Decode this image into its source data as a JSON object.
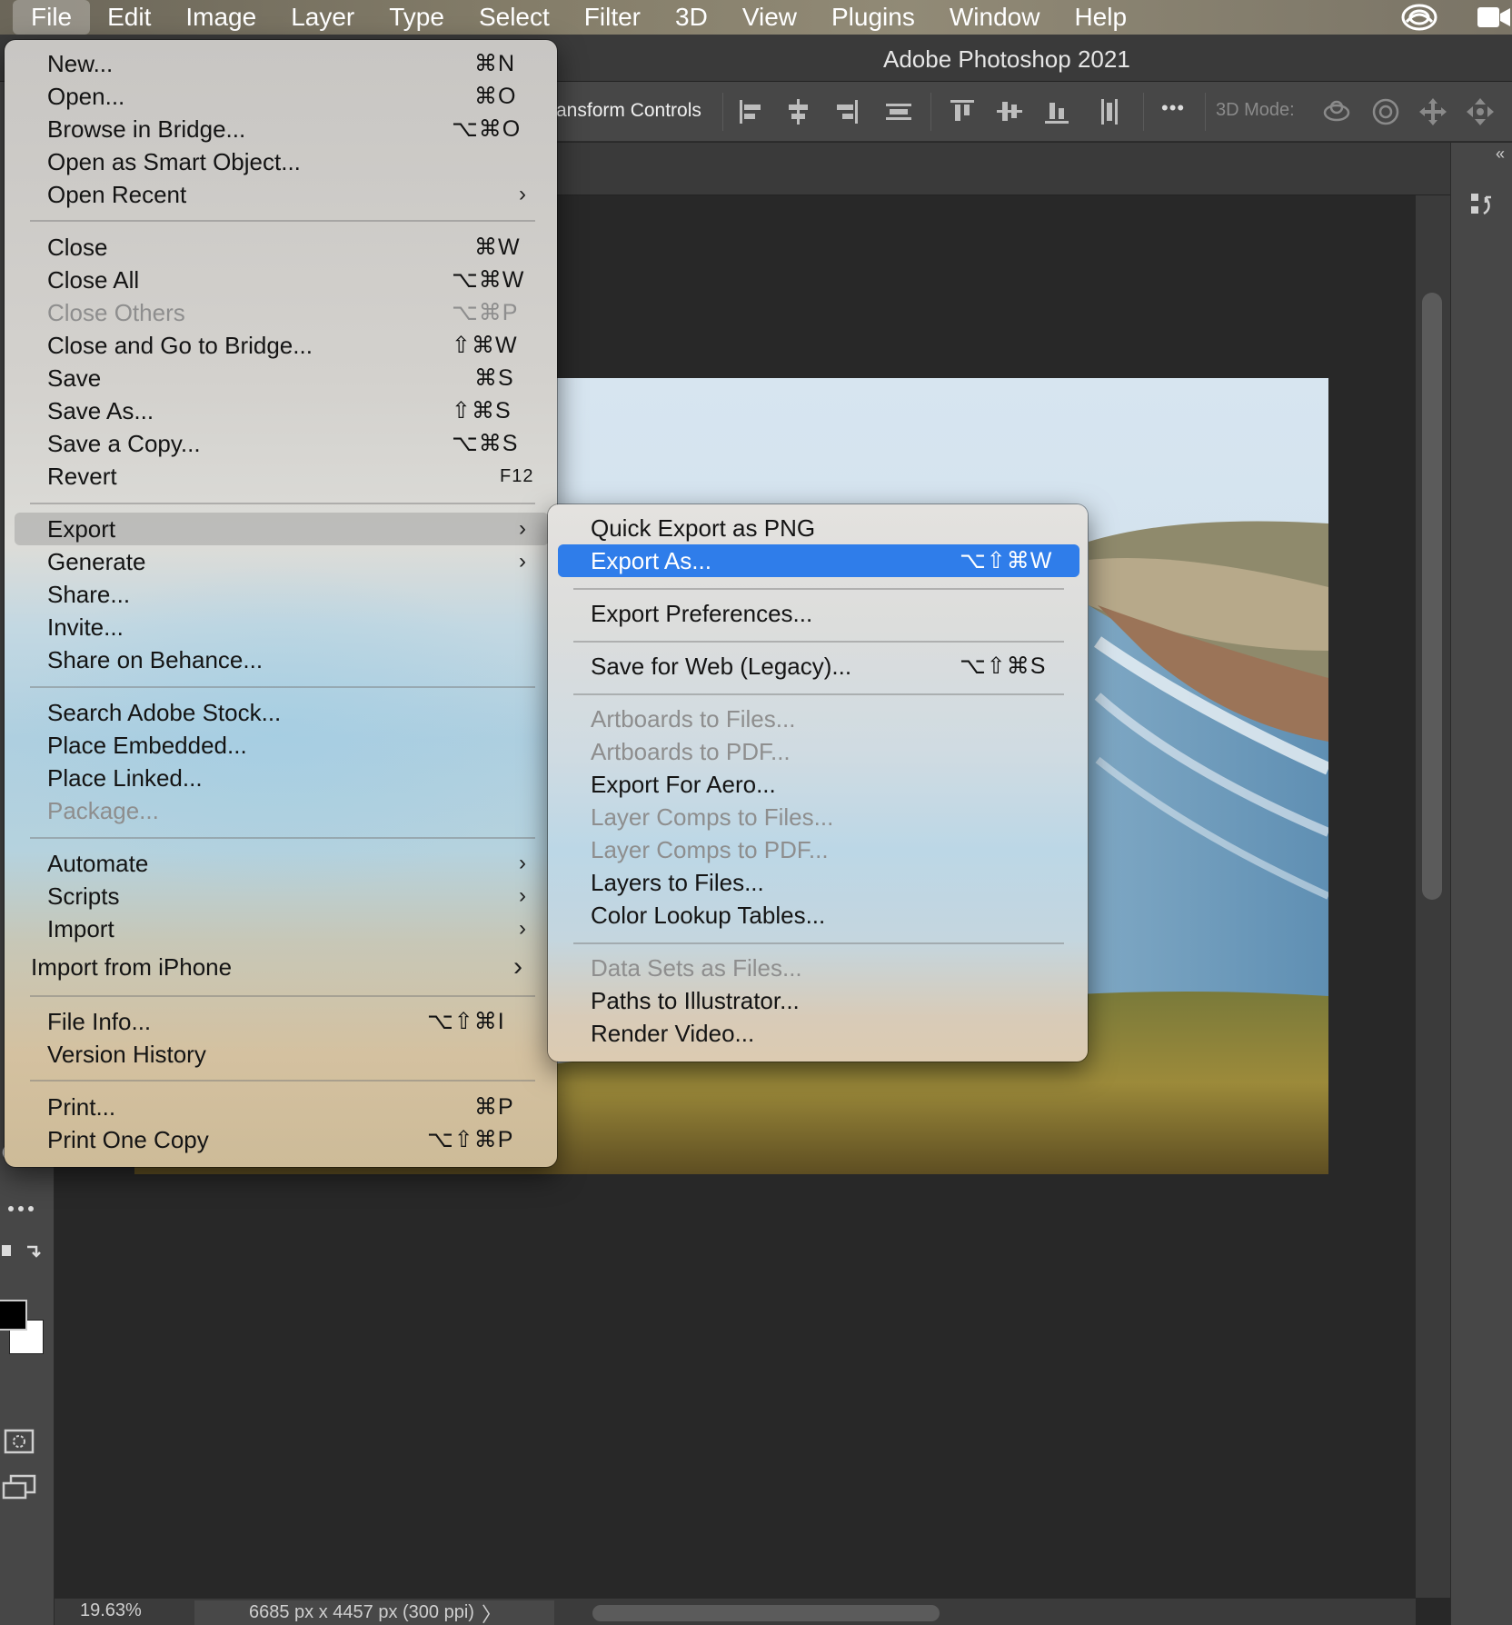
{
  "menubar": {
    "items": [
      "File",
      "Edit",
      "Image",
      "Layer",
      "Type",
      "Select",
      "Filter",
      "3D",
      "View",
      "Plugins",
      "Window",
      "Help"
    ],
    "active": "File",
    "right_icons": [
      "creative-cloud-icon",
      "facetime-icon"
    ]
  },
  "app": {
    "title": "Adobe Photoshop 2021"
  },
  "options_bar": {
    "transform_label": "ansform Controls",
    "mode_label": "3D Mode:",
    "more_label": "•••"
  },
  "file_menu": {
    "groups": [
      [
        {
          "label": "New...",
          "shortcut": "⌘N"
        },
        {
          "label": "Open...",
          "shortcut": "⌘O"
        },
        {
          "label": "Browse in Bridge...",
          "shortcut": "⌥⌘O"
        },
        {
          "label": "Open as Smart Object...",
          "shortcut": ""
        },
        {
          "label": "Open Recent",
          "submenu": true
        }
      ],
      [
        {
          "label": "Close",
          "shortcut": "⌘W"
        },
        {
          "label": "Close All",
          "shortcut": "⌥⌘W"
        },
        {
          "label": "Close Others",
          "shortcut": "⌥⌘P",
          "disabled": true
        },
        {
          "label": "Close and Go to Bridge...",
          "shortcut": "⇧⌘W"
        },
        {
          "label": "Save",
          "shortcut": "⌘S"
        },
        {
          "label": "Save As...",
          "shortcut": "⇧⌘S"
        },
        {
          "label": "Save a Copy...",
          "shortcut": "⌥⌘S"
        },
        {
          "label": "Revert",
          "shortcut": "F12"
        }
      ],
      [
        {
          "label": "Export",
          "submenu": true,
          "highlighted": true
        },
        {
          "label": "Generate",
          "submenu": true
        },
        {
          "label": "Share...",
          "shortcut": ""
        },
        {
          "label": "Invite...",
          "shortcut": ""
        },
        {
          "label": "Share on Behance...",
          "shortcut": ""
        }
      ],
      [
        {
          "label": "Search Adobe Stock...",
          "shortcut": ""
        },
        {
          "label": "Place Embedded...",
          "shortcut": ""
        },
        {
          "label": "Place Linked...",
          "shortcut": ""
        },
        {
          "label": "Package...",
          "shortcut": "",
          "disabled": true
        }
      ],
      [
        {
          "label": "Automate",
          "submenu": true
        },
        {
          "label": "Scripts",
          "submenu": true
        },
        {
          "label": "Import",
          "submenu": true
        },
        {
          "label": "Import from iPhone",
          "submenu": true
        }
      ],
      [
        {
          "label": "File Info...",
          "shortcut": "⌥⇧⌘I"
        },
        {
          "label": "Version History",
          "shortcut": ""
        }
      ],
      [
        {
          "label": "Print...",
          "shortcut": "⌘P"
        },
        {
          "label": "Print One Copy",
          "shortcut": "⌥⇧⌘P"
        }
      ]
    ]
  },
  "export_menu": {
    "groups": [
      [
        {
          "label": "Quick Export as PNG",
          "shortcut": ""
        },
        {
          "label": "Export As...",
          "shortcut": "⌥⇧⌘W",
          "highlighted": true
        }
      ],
      [
        {
          "label": "Export Preferences...",
          "shortcut": ""
        }
      ],
      [
        {
          "label": "Save for Web (Legacy)...",
          "shortcut": "⌥⇧⌘S"
        }
      ],
      [
        {
          "label": "Artboards to Files...",
          "disabled": true
        },
        {
          "label": "Artboards to PDF...",
          "disabled": true
        },
        {
          "label": "Export For Aero..."
        },
        {
          "label": "Layer Comps to Files...",
          "disabled": true
        },
        {
          "label": "Layer Comps to PDF...",
          "disabled": true
        },
        {
          "label": "Layers to Files..."
        },
        {
          "label": "Color Lookup Tables..."
        }
      ],
      [
        {
          "label": "Data Sets as Files...",
          "disabled": true
        },
        {
          "label": "Paths to Illustrator..."
        },
        {
          "label": "Render Video..."
        }
      ]
    ]
  },
  "status": {
    "zoom": "19.63%",
    "doc_size": "6685 px x 4457 px (300 ppi)",
    "arrow": "〉"
  },
  "colors": {
    "highlight": "#2f7dea",
    "canvas_bg": "#282828",
    "panel_bg": "#474747"
  }
}
